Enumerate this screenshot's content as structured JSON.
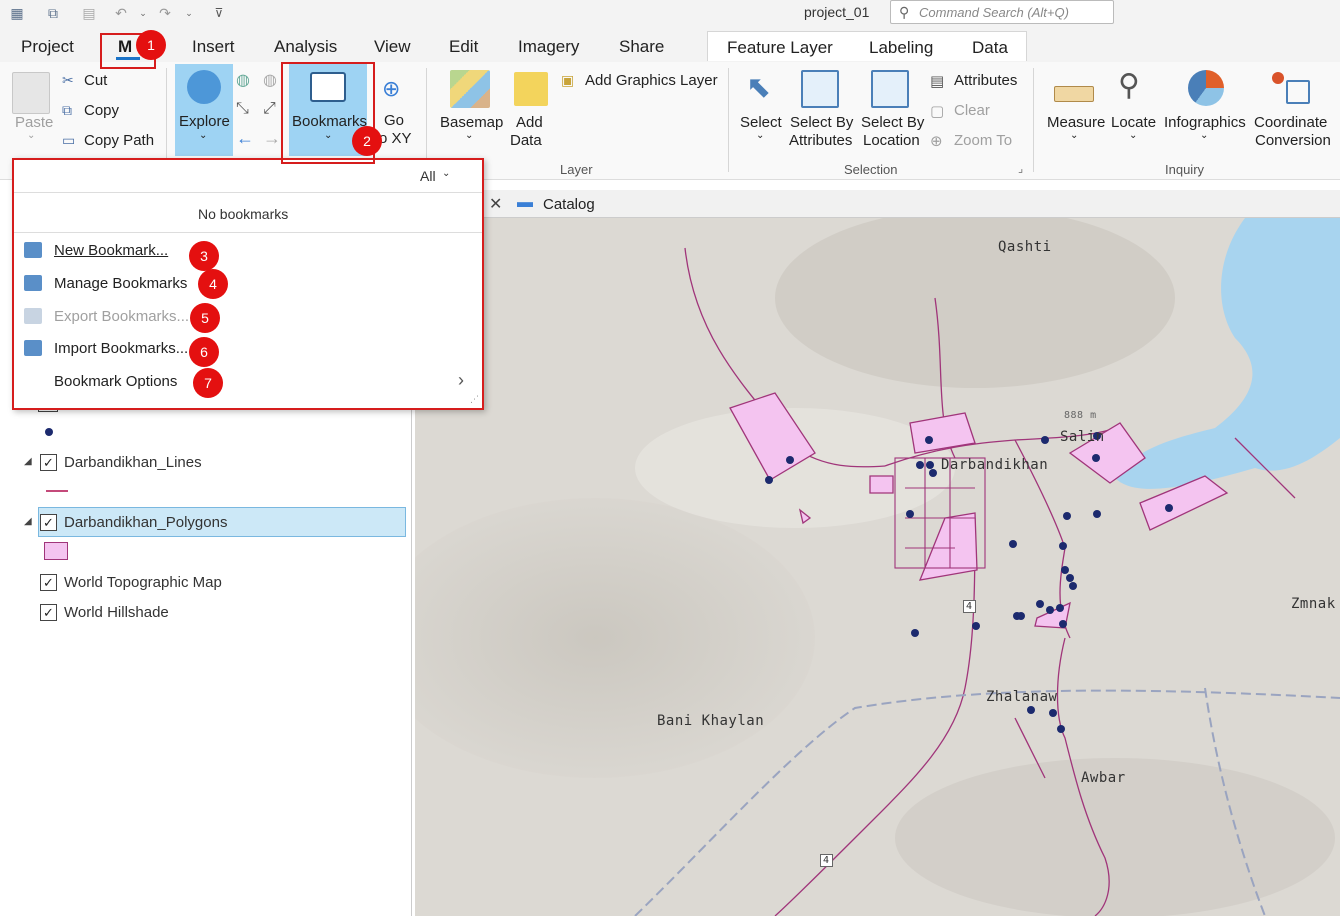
{
  "app": {
    "title": "project_01"
  },
  "command_search": {
    "placeholder": "Command Search (Alt+Q)"
  },
  "tabs": [
    "Project",
    "M",
    "Insert",
    "Analysis",
    "View",
    "Edit",
    "Imagery",
    "Share"
  ],
  "context_tabs": [
    "Feature Layer",
    "Labeling",
    "Data"
  ],
  "ribbon": {
    "clipboard": {
      "paste": "Paste",
      "cut": "Cut",
      "copy": "Copy",
      "copy_path": "Copy Path"
    },
    "navigate": {
      "explore": "Explore",
      "bookmarks": "Bookmarks",
      "go_to_xy_1": "Go",
      "go_to_xy_2": "o XY"
    },
    "layer": {
      "basemap": "Basemap",
      "add_data_1": "Add",
      "add_data_2": "Data",
      "add_graphics_layer": "Add Graphics Layer",
      "group_label": "Layer"
    },
    "selection": {
      "select": "Select",
      "select_by_attributes_1": "Select By",
      "select_by_attributes_2": "Attributes",
      "select_by_location_1": "Select By",
      "select_by_location_2": "Location",
      "attributes": "Attributes",
      "clear": "Clear",
      "zoom_to": "Zoom To",
      "group_label": "Selection"
    },
    "inquiry": {
      "measure": "Measure",
      "locate": "Locate",
      "infographics": "Infographics",
      "coordinate_conversion_1": "Coordinate",
      "coordinate_conversion_2": "Conversion",
      "group_label": "Inquiry"
    }
  },
  "bookmarks_menu": {
    "filter": "All",
    "empty_message": "No bookmarks",
    "items": [
      {
        "label": "New Bookmark...",
        "enabled": true
      },
      {
        "label": "Manage Bookmarks",
        "enabled": true
      },
      {
        "label": "Export Bookmarks...",
        "enabled": false
      },
      {
        "label": "Import Bookmarks...",
        "enabled": true
      },
      {
        "label": "Bookmark Options",
        "enabled": true
      }
    ]
  },
  "badges": [
    "1",
    "2",
    "3",
    "4",
    "5",
    "6",
    "7"
  ],
  "map_tab": {
    "label": "Catalog"
  },
  "contents": {
    "layers": [
      {
        "name": "Darbandikhan_Lines",
        "checked": true
      },
      {
        "name": "Darbandikhan_Polygons",
        "checked": true,
        "selected": true
      },
      {
        "name": "World Topographic Map",
        "checked": true
      },
      {
        "name": "World Hillshade",
        "checked": true
      }
    ]
  },
  "map": {
    "labels": [
      "Qashti",
      "Salin",
      "Darbandikhan",
      "Zmnak",
      "Zhalanaw",
      "Bani Khaylan",
      "Awbar",
      "888 m",
      "4",
      "4"
    ]
  },
  "colors": {
    "accent": "#1a73c8",
    "highlight": "#cce8f7",
    "polygon_fill": "#f4c4f0",
    "polygon_stroke": "#a0357a",
    "point": "#1c2a6e",
    "water": "#a8d4ef",
    "badge": "#e41010"
  }
}
